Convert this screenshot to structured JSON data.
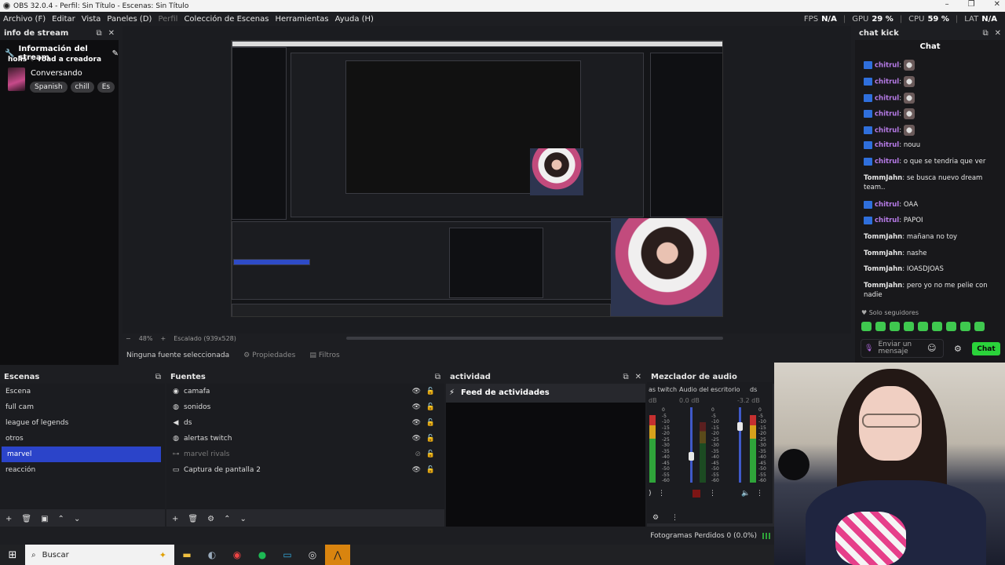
{
  "window": {
    "title": "OBS 32.0.4 - Perfil: Sin Título - Escenas: Sin Título"
  },
  "menu": [
    "Archivo (F)",
    "Editar",
    "Vista",
    "Paneles (D)",
    "Perfil",
    "Colección de Escenas",
    "Herramientas",
    "Ayuda (H)"
  ],
  "stats": {
    "fps_label": "FPS",
    "fps": "N/A",
    "gpu_label": "GPU",
    "gpu": "29 %",
    "cpu_label": "CPU",
    "cpu": "59 %",
    "lat_label": "LAT",
    "lat": "N/A"
  },
  "info_dock": {
    "header": "info de stream",
    "title": "Información del stream",
    "stream_title": "holis ♡ road a creadora",
    "category": "Conversando",
    "tags": [
      "Spanish",
      "chill",
      "Es"
    ]
  },
  "preview": {
    "zoom": "48%",
    "scale": "Escalado (939x528)",
    "no_source": "Ninguna fuente seleccionada",
    "properties": "Propiedades",
    "filters": "Filtros"
  },
  "chat": {
    "header": "chat kick",
    "title": "Chat",
    "messages": [
      {
        "user": "chitrul",
        "text": "",
        "emote": true,
        "kick": true
      },
      {
        "user": "chitrul",
        "text": "",
        "emote": true,
        "kick": true
      },
      {
        "user": "chitrul",
        "text": "",
        "emote": true,
        "kick": true
      },
      {
        "user": "chitrul",
        "text": "",
        "emote": true,
        "kick": true
      },
      {
        "user": "chitrul",
        "text": "",
        "emote": true,
        "kick": true
      },
      {
        "user": "chitrul",
        "text": "nouu",
        "emote": false,
        "kick": true
      },
      {
        "user": "chitrul",
        "text": "o que se tendria que ver",
        "emote": false,
        "kick": true
      },
      {
        "user": "TommJahn",
        "text": "se busca nuevo dream team..",
        "emote": false,
        "kick": false
      },
      {
        "user": "chitrul",
        "text": "OAA",
        "emote": false,
        "kick": true
      },
      {
        "user": "chitrul",
        "text": "PAPOI",
        "emote": false,
        "kick": true
      },
      {
        "user": "TommJahn",
        "text": "mañana no toy",
        "emote": false,
        "kick": false
      },
      {
        "user": "TommJahn",
        "text": "nashe",
        "emote": false,
        "kick": false
      },
      {
        "user": "TommJahn",
        "text": "IOASDJOAS",
        "emote": false,
        "kick": false
      },
      {
        "user": "TommJahn",
        "text": "pero yo no me pelie con nadie",
        "emote": false,
        "kick": false
      }
    ],
    "followers_only": "Solo seguidores",
    "input_placeholder": "Enviar un mensaje",
    "send_label": "Chat"
  },
  "scenes": {
    "header": "Escenas",
    "items": [
      "Escena",
      "full cam",
      "league of legends",
      "otros",
      "marvel",
      "reacción"
    ],
    "selected": "marvel"
  },
  "sources": {
    "header": "Fuentes",
    "items": [
      {
        "name": "camafa",
        "icon": "camera-icon",
        "visible": true
      },
      {
        "name": "sonidos",
        "icon": "globe-icon",
        "visible": true
      },
      {
        "name": "ds",
        "icon": "speaker-icon",
        "visible": true
      },
      {
        "name": "alertas twitch",
        "icon": "globe-icon",
        "visible": true
      },
      {
        "name": "marvel rivals",
        "icon": "gamepad-icon",
        "visible": false
      },
      {
        "name": "Captura de pantalla 2",
        "icon": "monitor-icon",
        "visible": true
      }
    ]
  },
  "activity": {
    "header": "actividad",
    "feed_title": "Feed de actividades"
  },
  "mixer": {
    "header": "Mezclador de audio",
    "channels": [
      {
        "name": "as twitch",
        "db": "dB",
        "level": 0.55,
        "active": true
      },
      {
        "name": "Audio del escritorio",
        "db": "0.0 dB",
        "level": 0.35,
        "active": false
      },
      {
        "name": "ds",
        "db": "-3.2 dB",
        "level": 0.75,
        "active": true
      }
    ],
    "scale": [
      "0",
      "-5",
      "-10",
      "-15",
      "-20",
      "-25",
      "-30",
      "-35",
      "-40",
      "-45",
      "-50",
      "-55",
      "-60"
    ]
  },
  "status": {
    "dropped_frames": "Fotogramas Perdidos 0 (0.0%)"
  },
  "taskbar": {
    "search": "Buscar"
  }
}
